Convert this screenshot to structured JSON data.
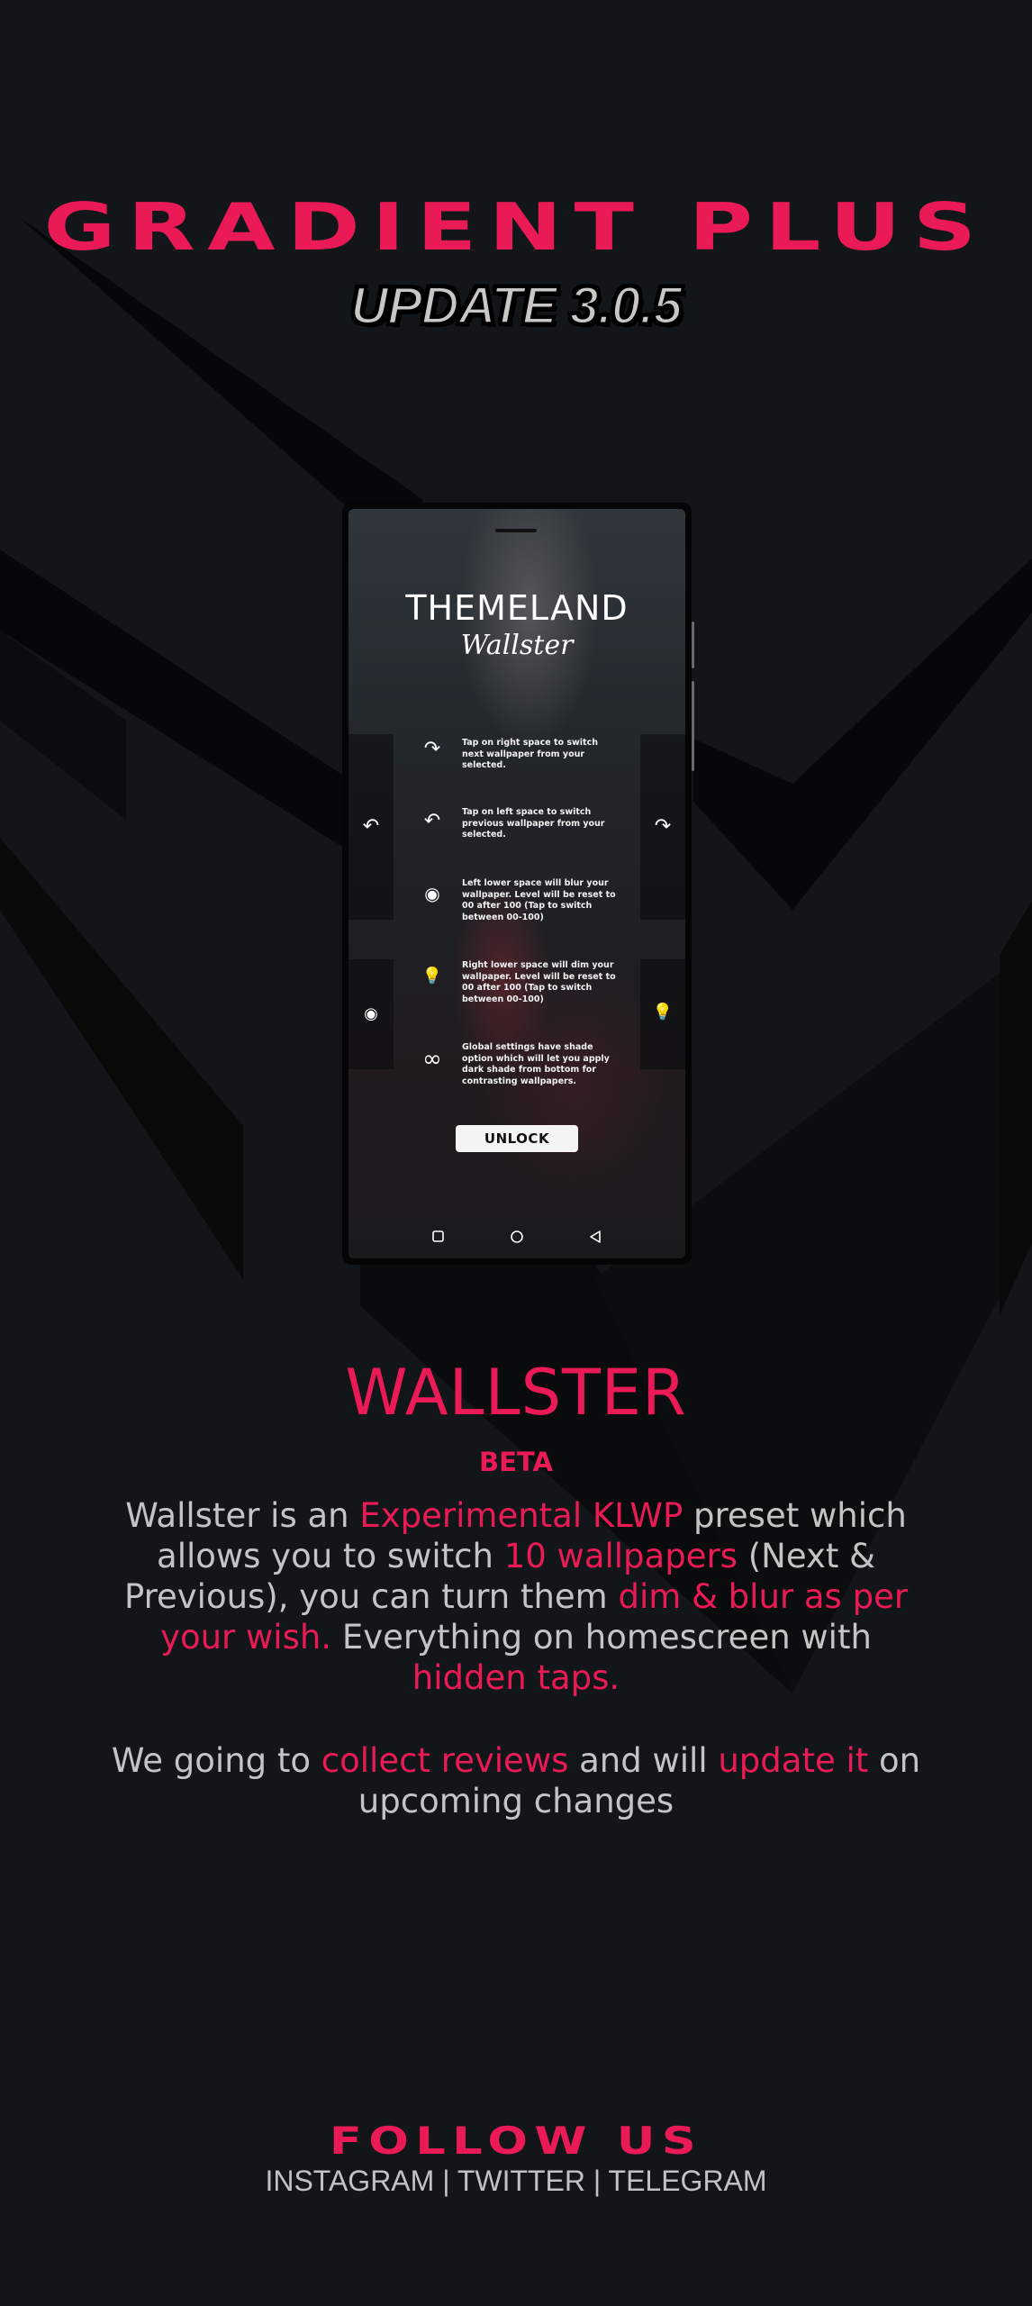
{
  "header": {
    "title": "GRADIENT PLUS",
    "update": "UPDATE 3.0.5"
  },
  "phone": {
    "brand": "THEMELAND",
    "subbrand": "Wallster",
    "side_icons": [
      "redo-icon",
      "undo-icon",
      "blur-icon",
      "bulb-icon"
    ],
    "instructions": [
      {
        "icon": "redo-icon",
        "glyph": "↷",
        "text": "Tap on right space to switch next wallpaper from your selected."
      },
      {
        "icon": "undo-icon",
        "glyph": "↶",
        "text": "Tap on left space to switch previous wallpaper from your selected."
      },
      {
        "icon": "blur-icon",
        "glyph": "◉",
        "text": "Left lower space will blur your wallpaper. Level will be reset to 00 after 100 (Tap to switch between 00-100)"
      },
      {
        "icon": "bulb-icon",
        "glyph": "💡",
        "text": "Right lower space will dim your wallpaper. Level will be reset to 00 after 100 (Tap to switch between 00-100)"
      },
      {
        "icon": "infinity-icon",
        "glyph": "∞",
        "text": "Global settings have shade option which will let you apply dark shade from bottom for contrasting wallpapers."
      }
    ],
    "unlock_label": "UNLOCK",
    "nav_icons": [
      "square-nav-icon",
      "circle-nav-icon",
      "back-triangle-icon"
    ]
  },
  "product": {
    "name": "WALLSTER",
    "tag": "BETA",
    "description": [
      {
        "t": "Wallster is an ",
        "h": false
      },
      {
        "t": "Experimental KLWP",
        "h": true
      },
      {
        "t": " preset which allows you to switch ",
        "h": false
      },
      {
        "t": "10 wallpapers",
        "h": true
      },
      {
        "t": " (Next & Previous), you can turn them ",
        "h": false
      },
      {
        "t": "dim & blur as per your wish.",
        "h": true
      },
      {
        "t": " Everything on homescreen with ",
        "h": false
      },
      {
        "t": "hidden taps.",
        "h": true
      }
    ],
    "note": [
      {
        "t": "We going to ",
        "h": false
      },
      {
        "t": "collect reviews",
        "h": true
      },
      {
        "t": " and will ",
        "h": false
      },
      {
        "t": "update it",
        "h": true
      },
      {
        "t": " on upcoming changes",
        "h": false
      }
    ]
  },
  "footer": {
    "follow": "FOLLOW US",
    "social": "INSTAGRAM | TWITTER | TELEGRAM"
  },
  "colors": {
    "accent": "#ea1a57",
    "background": "#131619",
    "text": "#c4c4c4"
  }
}
